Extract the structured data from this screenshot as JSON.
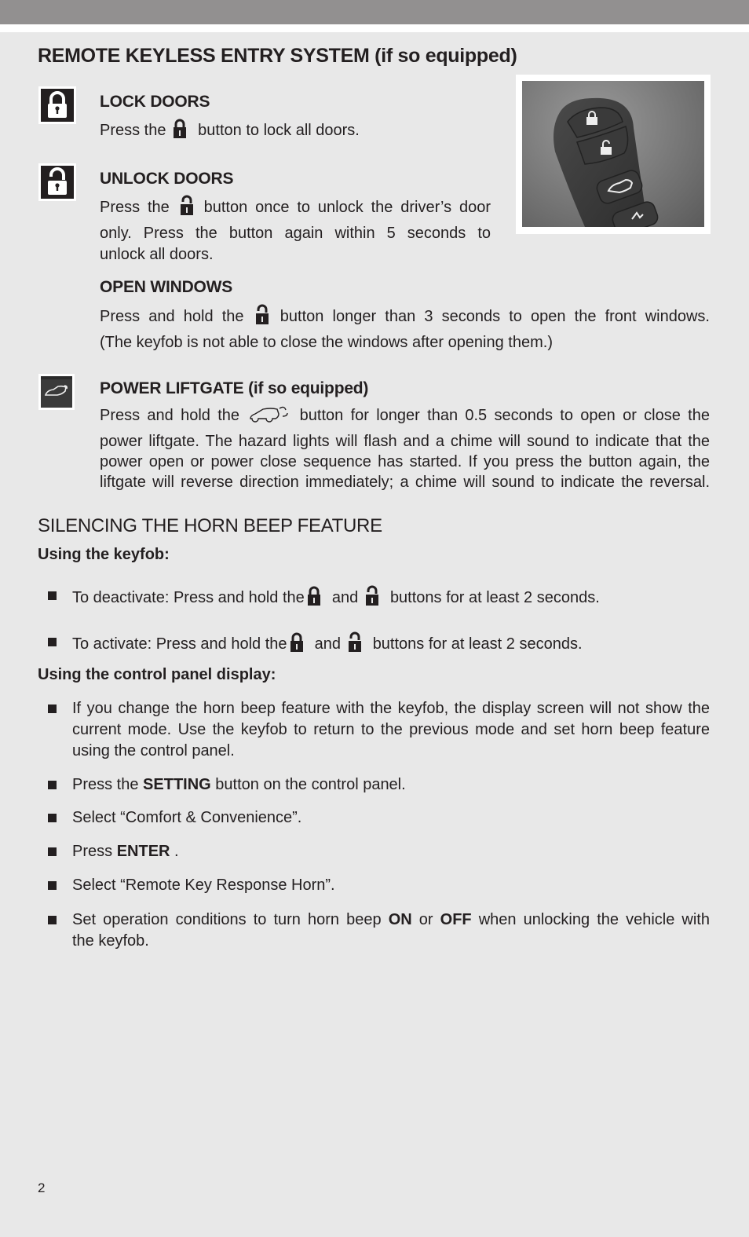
{
  "page": {
    "title": "REMOTE KEYLESS ENTRY SYSTEM (if so equipped)",
    "page_number": "2",
    "colors": {
      "header_bar": "#929090",
      "background": "#e8e8e8",
      "text": "#231f20"
    }
  },
  "sections": {
    "lock": {
      "icon": "lock-icon",
      "heading": "LOCK DOORS",
      "text_before": "Press the",
      "text_after": "button to lock all doors."
    },
    "unlock": {
      "icon": "unlock-icon",
      "heading": "UNLOCK DOORS",
      "line1_before": "Press the",
      "line1_after": "button once to unlock the driver’s door",
      "line2": "only. Press the button again within 5 seconds to",
      "line3": "unlock all doors."
    },
    "windows": {
      "heading": "OPEN WINDOWS",
      "line1_before": "Press and hold the",
      "line1_after": "button longer than 3 seconds to open the front windows.",
      "line2": "(The keyfob is not able to close the windows after opening them.)"
    },
    "liftgate": {
      "icon": "liftgate-icon",
      "heading": "POWER LIFTGATE (if so equipped)",
      "line1_before": "Press and hold the",
      "line1_after": "button for longer than 0.5 seconds to open or close the",
      "line2": "power liftgate. The hazard lights will flash and a chime will sound to indicate that the",
      "line3": "power open or power close sequence has started. If you press the button again, the",
      "line4": "liftgate will reverse direction immediately; a chime will sound to indicate the reversal."
    }
  },
  "keyfob_image": {
    "description": "keyfob photo",
    "buttons": [
      "lock",
      "unlock",
      "liftgate",
      "panic"
    ]
  },
  "horn": {
    "heading": "SILENCING THE HORN BEEP FEATURE",
    "keyfob_subheading": "Using the keyfob:",
    "keyfob_items": [
      {
        "before": "To deactivate: Press and hold the",
        "middle": "and",
        "after": "buttons for at least 2 seconds."
      },
      {
        "before": "To activate: Press and hold the",
        "middle": "and",
        "after": "buttons for at least 2 seconds."
      }
    ],
    "panel_subheading": "Using the control panel display:",
    "panel_items": {
      "item1": {
        "line1": "If you change the horn beep feature with the keyfob, the display screen will not show the",
        "line2": "current mode. Use the keyfob to return to the previous mode and set horn beep feature",
        "line3": "using the control panel."
      },
      "item2": {
        "before": "Press the",
        "bold": "SETTING",
        "after": "button on the control panel."
      },
      "item3": {
        "text": "Select “Comfort & Convenience”."
      },
      "item4": {
        "before": "Press",
        "bold": "ENTER",
        "after": "."
      },
      "item5": {
        "text": "Select “Remote Key Response Horn”."
      },
      "item6": {
        "before": "Set operation conditions to turn horn beep",
        "bold1": "ON",
        "mid": "or",
        "bold2": "OFF",
        "after": "when unlocking the vehicle with",
        "line2": "the keyfob."
      }
    }
  }
}
